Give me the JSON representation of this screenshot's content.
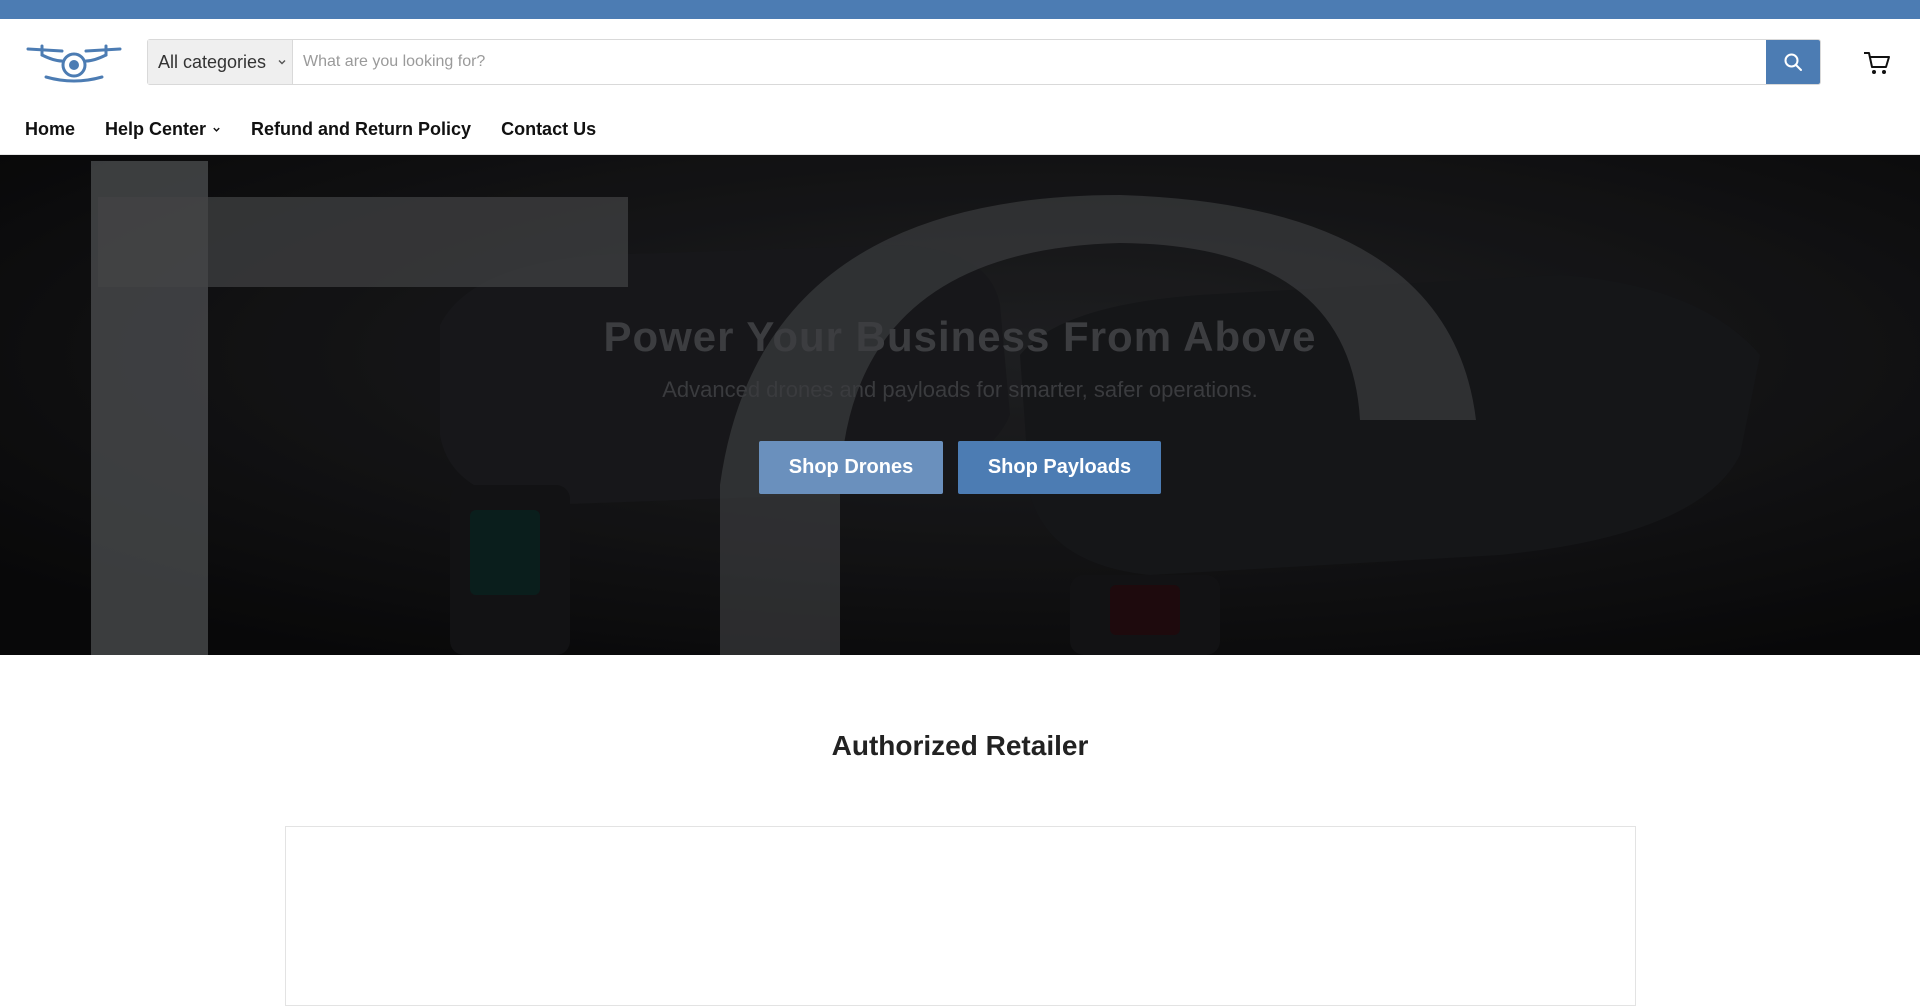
{
  "header": {
    "search": {
      "category_label": "All categories",
      "placeholder": "What are you looking for?"
    }
  },
  "nav": {
    "items": [
      {
        "label": "Home"
      },
      {
        "label": "Help Center"
      },
      {
        "label": "Refund and Return Policy"
      },
      {
        "label": "Contact Us"
      }
    ]
  },
  "hero": {
    "title": "Power Your Business From Above",
    "subtitle": "Advanced drones and payloads for smarter, safer operations.",
    "buttons": [
      {
        "label": "Shop Drones"
      },
      {
        "label": "Shop Payloads"
      }
    ]
  },
  "main": {
    "section_title": "Authorized Retailer"
  },
  "colors": {
    "accent": "#4c7cb3",
    "accent_light": "#6a90bd",
    "hero_bg": "#151618"
  },
  "icons": [
    "drone-logo",
    "chevron-down-icon",
    "search-icon",
    "cart-icon"
  ]
}
